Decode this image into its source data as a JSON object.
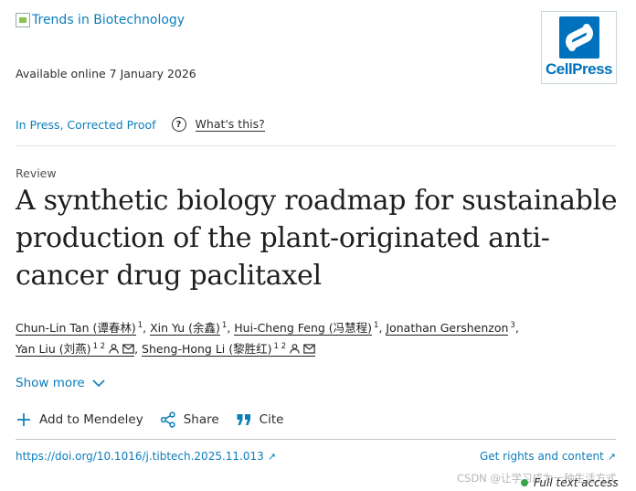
{
  "header": {
    "journal_name": "Trends in Biotechnology",
    "available_online": "Available online 7 January 2026",
    "publisher_logo_text": "CellPress",
    "publisher_logo_color": "#0071bc"
  },
  "status": {
    "label": "In Press, Corrected Proof",
    "help_icon": "help-circle-icon",
    "whats_this": "What's this?"
  },
  "article": {
    "type": "Review",
    "title": "A synthetic biology roadmap for sustainable production of the plant-originated anti-cancer drug paclitaxel"
  },
  "authors": [
    {
      "name": "Chun-Lin Tan (谭春林)",
      "sup": "1",
      "icons": []
    },
    {
      "name": "Xin Yu (余鑫)",
      "sup": "1",
      "icons": []
    },
    {
      "name": "Hui-Cheng Feng (冯慧程)",
      "sup": "1",
      "icons": []
    },
    {
      "name": "Jonathan Gershenzon",
      "sup": "3",
      "icons": []
    },
    {
      "name": "Yan Liu (刘燕)",
      "sup": "1 2",
      "icons": [
        "person-icon",
        "mail-icon"
      ]
    },
    {
      "name": "Sheng-Hong Li (黎胜红)",
      "sup": "1 2",
      "icons": [
        "person-icon",
        "mail-icon"
      ]
    }
  ],
  "show_more": "Show more",
  "actions": {
    "mendeley": "Add to Mendeley",
    "share": "Share",
    "cite": "Cite"
  },
  "footer": {
    "doi": "https://doi.org/10.1016/j.tibtech.2025.11.013",
    "rights": "Get rights and content",
    "access": "Full text access",
    "watermark": "CSDN @让学习成为一种生活方式"
  },
  "colors": {
    "link": "#0c7dbb",
    "access_dot": "#37a34a"
  }
}
